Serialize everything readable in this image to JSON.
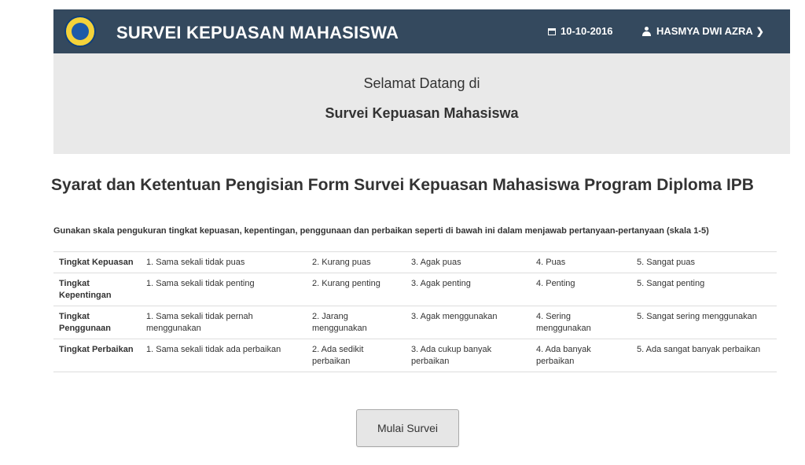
{
  "navbar": {
    "brand": "SURVEI KEPUASAN MAHASISWA",
    "date": "10-10-2016",
    "user": "HASMYA DWI AZRA"
  },
  "jumbotron": {
    "welcome": "Selamat Datang di",
    "title": "Survei Kepuasan Mahasiswa"
  },
  "heading": "Syarat dan Ketentuan Pengisian Form Survei Kepuasan Mahasiswa Program Diploma IPB",
  "intro": "Gunakan skala pengukuran tingkat kepuasan, kepentingan, penggunaan dan perbaikan seperti di bawah ini dalam menjawab pertanyaan-pertanyaan (skala 1-5)",
  "table": {
    "rows": [
      {
        "label": "Tingkat Kepuasan",
        "cells": [
          "1. Sama sekali tidak puas",
          "2. Kurang puas",
          "3. Agak puas",
          "4. Puas",
          "5. Sangat puas"
        ]
      },
      {
        "label": "Tingkat Kepentingan",
        "cells": [
          "1. Sama sekali tidak penting",
          "2. Kurang penting",
          "3. Agak penting",
          "4. Penting",
          "5. Sangat penting"
        ]
      },
      {
        "label": "Tingkat Penggunaan",
        "cells": [
          "1. Sama sekali tidak pernah menggunakan",
          "2. Jarang menggunakan",
          "3. Agak menggunakan",
          "4. Sering menggunakan",
          "5. Sangat sering menggunakan"
        ]
      },
      {
        "label": "Tingkat Perbaikan",
        "cells": [
          "1. Sama sekali tidak ada perbaikan",
          "2. Ada sedikit perbaikan",
          "3. Ada cukup banyak perbaikan",
          "4. Ada banyak perbaikan",
          "5. Ada sangat banyak perbaikan"
        ]
      }
    ]
  },
  "button": {
    "label": "Mulai Survei"
  },
  "colors": {
    "navbar": "#34495e",
    "jumbotron": "#e9e9e9"
  },
  "icons": {
    "logo": "university-seal-logo",
    "date": "calendar-icon",
    "user": "user-icon",
    "dropdown": "chevron-down-icon"
  }
}
